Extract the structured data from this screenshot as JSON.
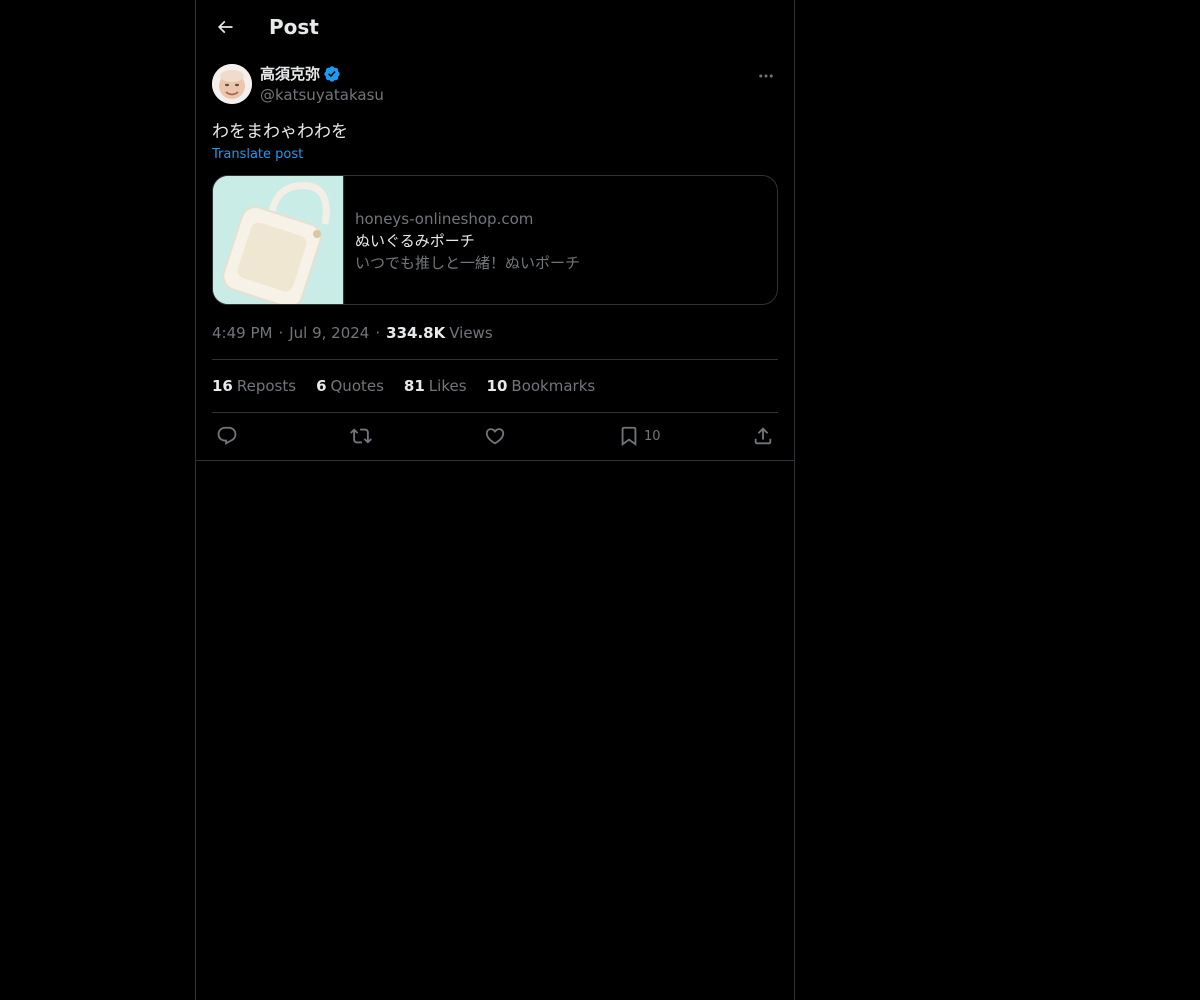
{
  "header": {
    "title": "Post"
  },
  "post": {
    "author": {
      "name": "高須克弥",
      "handle": "@katsuyatakasu",
      "verified": true
    },
    "text": "わをまわゃわわを",
    "translate_label": "Translate post",
    "card": {
      "domain": "honeys-onlineshop.com",
      "title": "ぬいぐるみポーチ",
      "description": "いつでも推しと一緒！ぬいポーチ"
    },
    "meta": {
      "time": "4:49 PM",
      "date": "Jul 9, 2024",
      "views_count": "334.8K",
      "views_label": "Views",
      "separator": "·"
    },
    "stats": {
      "reposts_count": "16",
      "reposts_label": "Reposts",
      "quotes_count": "6",
      "quotes_label": "Quotes",
      "likes_count": "81",
      "likes_label": "Likes",
      "bookmarks_count": "10",
      "bookmarks_label": "Bookmarks"
    },
    "actions": {
      "bookmark_count": "10"
    }
  },
  "colors": {
    "background": "#000000",
    "text_primary": "#e7e9ea",
    "text_secondary": "#71767b",
    "accent": "#1d9bf0",
    "border": "#2f3336"
  }
}
